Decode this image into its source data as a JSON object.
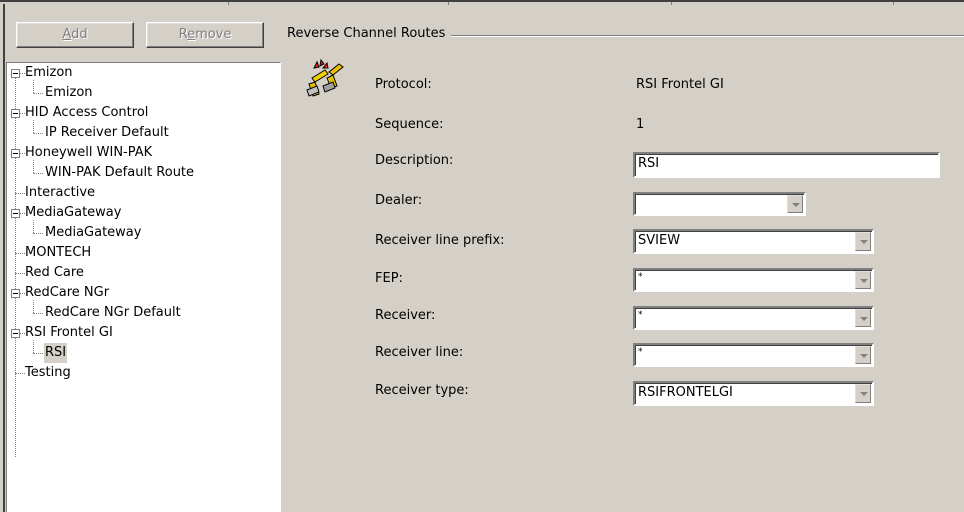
{
  "toolbar": {
    "add_label_pre": "",
    "add_label_ul": "A",
    "add_label_post": "dd",
    "remove_label_pre": "R",
    "remove_label_ul": "e",
    "remove_label_post": "move"
  },
  "tree": {
    "items": [
      {
        "label": "Emizon"
      },
      {
        "label": "Emizon"
      },
      {
        "label": "HID Access Control"
      },
      {
        "label": "IP Receiver Default"
      },
      {
        "label": "Honeywell WIN-PAK"
      },
      {
        "label": "WIN-PAK Default Route"
      },
      {
        "label": "Interactive"
      },
      {
        "label": "MediaGateway"
      },
      {
        "label": "MediaGateway"
      },
      {
        "label": "MONTECH"
      },
      {
        "label": "Red Care"
      },
      {
        "label": "RedCare NGr"
      },
      {
        "label": "RedCare NGr Default"
      },
      {
        "label": "RSI Frontel GI"
      },
      {
        "label": "RSI"
      },
      {
        "label": "Testing"
      }
    ]
  },
  "details": {
    "group_title": "Reverse Channel Routes",
    "protocol_label": "Protocol:",
    "protocol_value": "RSI Frontel GI",
    "sequence_label": "Sequence:",
    "sequence_value": "1",
    "description_label": "Description:",
    "description_value": "RSI",
    "dealer_label": "Dealer:",
    "dealer_value": "",
    "prefix_label": "Receiver line prefix:",
    "prefix_value": "SVIEW",
    "fep_label": "FEP:",
    "fep_value": "*",
    "receiver_label": "Receiver:",
    "receiver_value": "*",
    "receiver_line_label": "Receiver line:",
    "receiver_line_value": "*",
    "receiver_type_label": "Receiver type:",
    "receiver_type_value": "RSIFRONTELGI"
  },
  "icons": {
    "route_icon": "reverse-channel-route-icon"
  }
}
